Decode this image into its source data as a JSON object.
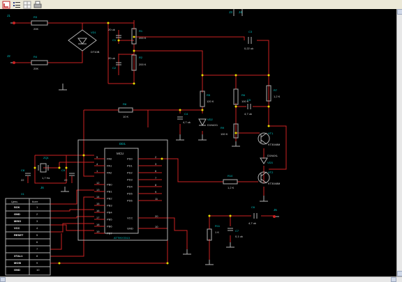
{
  "toolbar": {
    "icons": [
      "component-icon",
      "list-icon",
      "grid-icon",
      "printer-icon"
    ]
  },
  "schematic": {
    "colors": {
      "wire": "#cc2222",
      "body": "#b0b0b0",
      "text": "#00c8c8",
      "dot": "#e8e000",
      "bg": "#000000",
      "label": "#d8d8d8"
    },
    "connectors": {
      "j1": {
        "ref": "J1"
      },
      "j2": {
        "ref": "J2"
      },
      "j3": {
        "ref": "J3"
      },
      "j4": {
        "ref": "J4"
      },
      "j5": {
        "ref": "J5"
      },
      "j6": {
        "ref": "J6"
      }
    },
    "resistors": [
      {
        "ref": "R3",
        "val": "20K"
      },
      {
        "ref": "R4",
        "val": "20K"
      },
      {
        "ref": "R1",
        "val": "200 K"
      },
      {
        "ref": "R2",
        "val": "200 K"
      },
      {
        "ref": "R5",
        "val": "120 K"
      },
      {
        "ref": "R6",
        "val": "100 K"
      },
      {
        "ref": "R7",
        "val": "1,2 K"
      },
      {
        "ref": "R8",
        "val": "10 K"
      },
      {
        "ref": "R9",
        "val": "100 K"
      },
      {
        "ref": "R10",
        "val": "1,2 K"
      },
      {
        "ref": "R11",
        "val": "1 K"
      }
    ],
    "capacitors": [
      {
        "ref": "C1",
        "val": "20 uk"
      },
      {
        "ref": "C2",
        "val": "20 uk"
      },
      {
        "ref": "C3",
        "val": "0,22 uk"
      },
      {
        "ref": "C4",
        "val": "4,7 uk"
      },
      {
        "ref": "C5",
        "val": "4,7 uk"
      },
      {
        "ref": "C6",
        "val": "4,7 uk"
      },
      {
        "ref": "C7",
        "val": "0,1 uk"
      },
      {
        "ref": "C8",
        "val": "22"
      },
      {
        "ref": "C9",
        "val": "22"
      }
    ],
    "bridge": {
      "ref": "VD1",
      "part": "DT10B"
    },
    "zener1": {
      "ref": "VD2",
      "part": "D1N4X1"
    },
    "zener2": {
      "ref": "VD3",
      "part": "D1N4XL"
    },
    "crystal": {
      "ref": "ZQ1",
      "val": "1,7 Hz"
    },
    "transistors": [
      {
        "ref": "VT1",
        "part": "KT3048M"
      },
      {
        "ref": "VT2",
        "part": "KT3048M"
      }
    ],
    "mcu": {
      "ref": "DD1",
      "title": "MCU",
      "part": "ATTINY2313",
      "left_pins": [
        {
          "num": "5",
          "name": "PA0"
        },
        {
          "num": "4",
          "name": "PA1"
        },
        {
          "num": "1",
          "name": "PA2"
        },
        {
          "num": "12",
          "name": "PB0"
        },
        {
          "num": "13",
          "name": "PB1"
        },
        {
          "num": "14",
          "name": "PB2"
        },
        {
          "num": "15",
          "name": "PB3"
        },
        {
          "num": "16",
          "name": "PB4"
        },
        {
          "num": "17",
          "name": "PB5"
        },
        {
          "num": "18",
          "name": "PB6"
        },
        {
          "num": "19",
          "name": "PB7"
        }
      ],
      "right_pins": [
        {
          "num": "2",
          "name": "PD0"
        },
        {
          "num": "3",
          "name": "PD1"
        },
        {
          "num": "6",
          "name": "PD2"
        },
        {
          "num": "7",
          "name": "PD3"
        },
        {
          "num": "8",
          "name": "PD4"
        },
        {
          "num": "9",
          "name": "PD5"
        },
        {
          "num": "11",
          "name": "PD6"
        },
        {
          "num": "20",
          "name": "VCC"
        },
        {
          "num": "10",
          "name": "GND"
        }
      ]
    },
    "header": {
      "ref": "X1",
      "col1": "Цепь",
      "col2": "Конт",
      "rows": [
        {
          "name": "SCK",
          "num": "1"
        },
        {
          "name": "GND",
          "num": "2"
        },
        {
          "name": "MISO",
          "num": "3"
        },
        {
          "name": "VCC",
          "num": "4"
        },
        {
          "name": "RESET",
          "num": "5"
        },
        {
          "name": "",
          "num": "6"
        },
        {
          "name": "",
          "num": "7"
        },
        {
          "name": "XTAL1",
          "num": "8"
        },
        {
          "name": "MOSI",
          "num": "9"
        },
        {
          "name": "GND",
          "num": "10"
        }
      ]
    }
  }
}
